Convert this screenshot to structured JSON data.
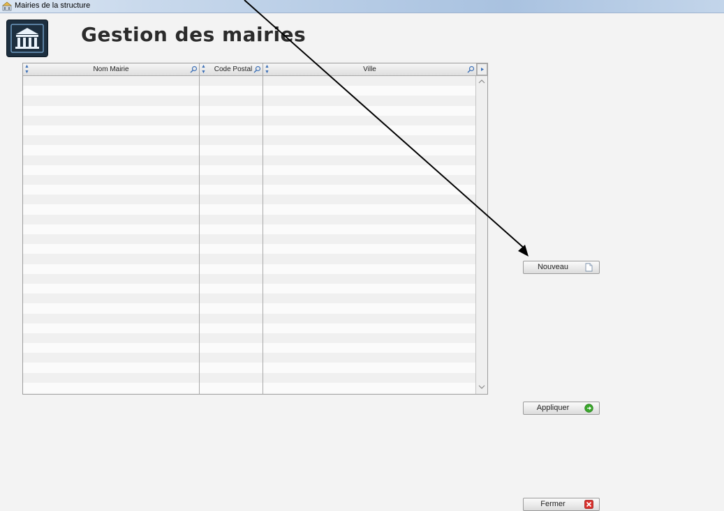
{
  "window": {
    "title": "Mairies de la structure",
    "icon": "app-window-icon"
  },
  "header": {
    "logo_icon": "town-hall-icon",
    "page_title": "Gestion des mairies"
  },
  "table": {
    "columns": [
      {
        "label": "Nom Mairie",
        "sortable": true,
        "searchable": true
      },
      {
        "label": "Code Postal",
        "sortable": true,
        "searchable": true
      },
      {
        "label": "Ville",
        "sortable": true,
        "searchable": true
      }
    ],
    "rows": [],
    "empty_row_count": 32
  },
  "actions": {
    "new_label": "Nouveau",
    "new_icon": "new-document-icon",
    "apply_label": "Appliquer",
    "apply_icon": "apply-green-icon",
    "close_label": "Fermer",
    "close_icon": "close-red-icon"
  },
  "colors": {
    "titlebar": "#b8cde6",
    "logo_bg": "#1d2f3f",
    "sort_arrow": "#3b6fb6",
    "apply_green": "#3aa82c",
    "close_red": "#d9302c"
  }
}
